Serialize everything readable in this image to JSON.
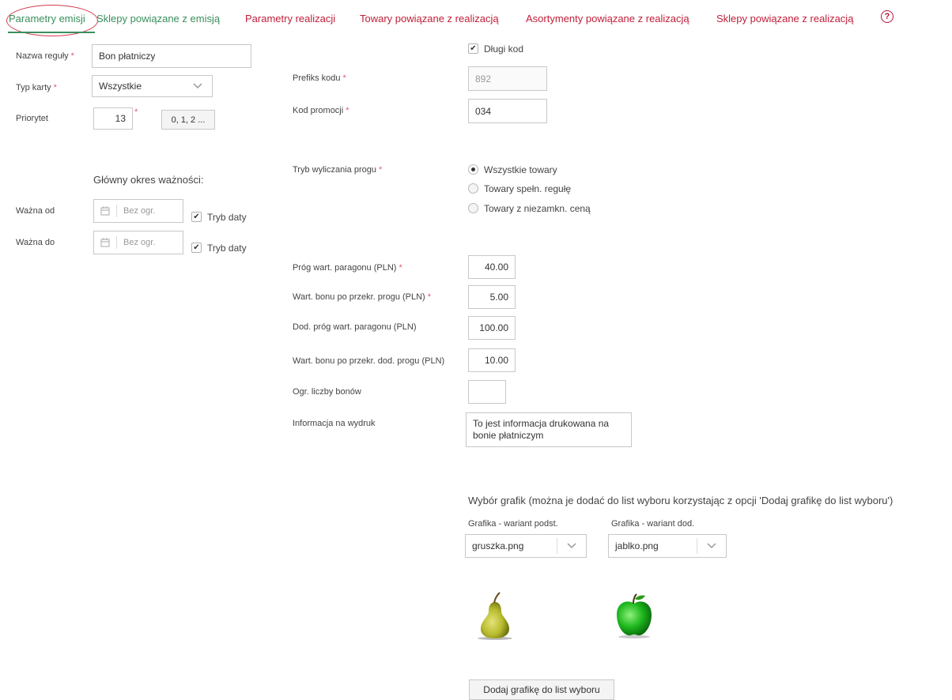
{
  "tabs": [
    {
      "label": "Parametry emisji"
    },
    {
      "label": "Sklepy powiązane z emisją"
    },
    {
      "label": "Parametry realizacji"
    },
    {
      "label": "Towary powiązane z realizacją"
    },
    {
      "label": "Asortymenty powiązane z realizacją"
    },
    {
      "label": "Sklepy powiązane z realizacją"
    }
  ],
  "help_icon": "?",
  "left": {
    "rule_name_label": "Nazwa reguły",
    "rule_name_value": "Bon płatniczy",
    "card_type_label": "Typ karty",
    "card_type_value": "Wszystkie",
    "priority_label": "Priorytet",
    "priority_value": "13",
    "priority_button": "0, 1, 2 ...",
    "validity_heading": "Główny okres ważności:",
    "valid_from_label": "Ważna od",
    "valid_from_placeholder": "Bez ogr.",
    "valid_to_label": "Ważna do",
    "valid_to_placeholder": "Bez ogr.",
    "date_mode_label": "Tryb daty",
    "required_mark": "*"
  },
  "right": {
    "long_code_label": "Długi kod",
    "code_prefix_label": "Prefiks kodu",
    "code_prefix_value": "892",
    "promo_code_label": "Kod promocji",
    "promo_code_value": "034",
    "threshold_mode_label": "Tryb wyliczania progu",
    "threshold_options": [
      "Wszystkie towary",
      "Towary spełn. regułę",
      "Towary z niezamkn. ceną"
    ],
    "fields": [
      {
        "label": "Próg wart. paragonu (PLN)",
        "required": true,
        "value": "40.00"
      },
      {
        "label": "Wart. bonu po przekr. progu (PLN)",
        "required": true,
        "value": "5.00"
      },
      {
        "label": "Dod. próg wart. paragonu (PLN)",
        "required": false,
        "value": "100.00"
      },
      {
        "label": "Wart. bonu po przekr. dod. progu (PLN)",
        "required": false,
        "value": "10.00"
      },
      {
        "label": "Ogr. liczby bonów",
        "required": false,
        "value": ""
      }
    ],
    "print_info_label": "Informacja na wydruk",
    "print_info_value": "To jest informacja drukowana na bonie płatniczym"
  },
  "graphics": {
    "heading": "Wybór grafik (można je dodać do list wyboru korzystając z opcji 'Dodaj grafikę do list wyboru')",
    "basic_label": "Grafika - wariant podst.",
    "basic_value": "gruszka.png",
    "extra_label": "Grafika - wariant dod.",
    "extra_value": "jablko.png",
    "basic_image_icon": "pear-icon",
    "extra_image_icon": "apple-icon",
    "add_button": "Dodaj grafikę do list wyboru"
  },
  "colors": {
    "active_tab": "#3a8f5d",
    "inactive_tab": "#c0203a",
    "required": "#e05a6b",
    "annotation_circle": "#d23b4f"
  }
}
